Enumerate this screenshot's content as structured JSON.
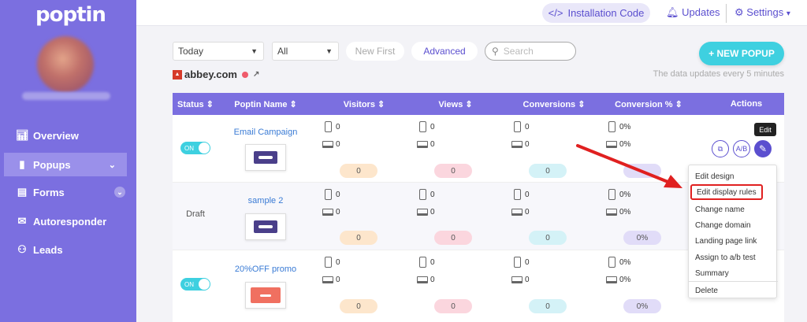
{
  "sidebar": {
    "logo": "poptin",
    "items": [
      {
        "label": "Overview",
        "icon": "chart-icon"
      },
      {
        "label": "Popups",
        "icon": "popup-icon",
        "active": true
      },
      {
        "label": "Forms",
        "icon": "form-icon"
      },
      {
        "label": "Autoresponder",
        "icon": "mail-icon"
      },
      {
        "label": "Leads",
        "icon": "leads-icon"
      }
    ]
  },
  "topbar": {
    "install_label": "Installation Code",
    "install_icon": "</>",
    "updates_label": "Updates",
    "settings_label": "Settings"
  },
  "filters": {
    "date_value": "Today",
    "type_value": "All",
    "sort_label": "New First",
    "advanced_label": "Advanced",
    "search_placeholder": "Search",
    "new_popup_label": "+ NEW POPUP"
  },
  "site": {
    "domain": "abbey.com",
    "update_note": "The data updates every 5 minutes"
  },
  "table": {
    "headers": [
      "Status",
      "Poptin Name",
      "Visitors",
      "Views",
      "Conversions",
      "Conversion %",
      "Actions"
    ],
    "rows": [
      {
        "status": "ON",
        "name": "Email Campaign",
        "visitors": [
          "0",
          "0"
        ],
        "views": [
          "0",
          "0"
        ],
        "conversions": [
          "0",
          "0"
        ],
        "rate": [
          "0%",
          "0%"
        ],
        "badges": [
          "0",
          "0",
          "0",
          ""
        ]
      },
      {
        "status": "Draft",
        "name": "sample 2",
        "visitors": [
          "0",
          "0"
        ],
        "views": [
          "0",
          "0"
        ],
        "conversions": [
          "0",
          "0"
        ],
        "rate": [
          "0%",
          "0%"
        ],
        "badges": [
          "0",
          "0",
          "0",
          "0%"
        ]
      },
      {
        "status": "ON",
        "name": "20%OFF promo",
        "visitors": [
          "0",
          "0"
        ],
        "views": [
          "0",
          "0"
        ],
        "conversions": [
          "0",
          "0"
        ],
        "rate": [
          "0%",
          "0%"
        ],
        "badges": [
          "0",
          "0",
          "0",
          "0%"
        ]
      }
    ]
  },
  "actions": {
    "tooltip": "Edit",
    "copy_icon": "copy-icon",
    "ab_label": "A/B",
    "edit_icon": "pencil-icon"
  },
  "menu": {
    "items": [
      "Edit design",
      "Edit display rules",
      "Change name",
      "Change domain",
      "Landing page link",
      "Assign to a/b test",
      "Summary",
      "Delete"
    ],
    "highlighted": "Edit display rules"
  },
  "colors": {
    "sidebar": "#7b6fe0",
    "accent": "#5b4fcf",
    "cta": "#3ed0e0",
    "highlight": "#e02020"
  }
}
